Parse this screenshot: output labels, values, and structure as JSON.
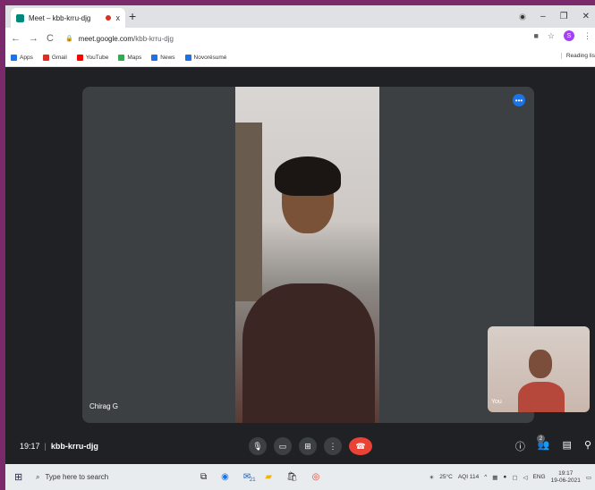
{
  "browser": {
    "tab_title": "Meet – kbb-krru-djg",
    "tab_close": "x",
    "new_tab": "+",
    "url_domain": "meet.google.com",
    "url_path": "/kbb-krru-djg",
    "profile_initial": "S",
    "reading_list": "Reading lis"
  },
  "bookmarks": [
    {
      "label": "Apps",
      "color": "#1a73e8"
    },
    {
      "label": "Gmail",
      "color": "#d93025"
    },
    {
      "label": "YouTube",
      "color": "#ff0000"
    },
    {
      "label": "Maps",
      "color": "#34a853"
    },
    {
      "label": "News",
      "color": "#1a73e8"
    },
    {
      "label": "Novorésumé",
      "color": "#1a73e8"
    }
  ],
  "meeting": {
    "main_participant": "Chirag G",
    "self_label": "You",
    "time": "19:17",
    "code": "kbb-krru-djg",
    "participant_count": "2",
    "end_color": "#ea4335"
  },
  "taskbar": {
    "search_placeholder": "Type here to search",
    "weather": "25°C",
    "aqi": "AQI 114",
    "lang": "ENG",
    "time": "19:17",
    "date": "19-06-2021",
    "calendar_badge": "21"
  }
}
